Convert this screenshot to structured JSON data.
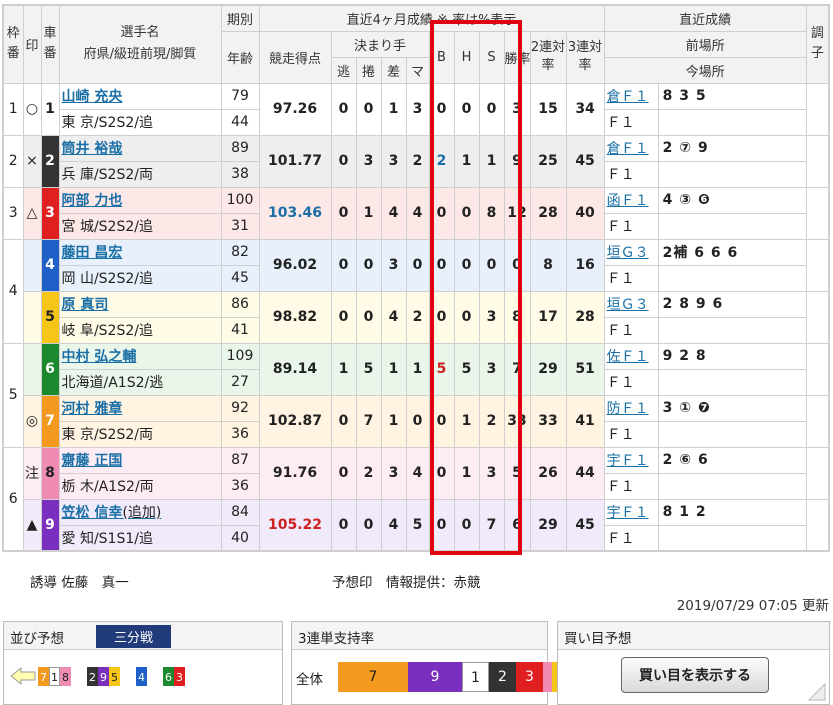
{
  "header": {
    "frame_label": "枠番",
    "mark_label": "印",
    "car_label": "車番",
    "rider_label1": "選手名",
    "rider_label2": "府県/級班前現/脚質",
    "period_label": "期別",
    "age_label": "年齢",
    "recent_label": "直近4ヶ月成績  ※ 率は%表示",
    "points_label": "競走得点",
    "kimarite_label": "決まり手",
    "k1": "逃",
    "k2": "捲",
    "k3": "差",
    "k4": "マ",
    "b": "B",
    "h": "H",
    "s": "S",
    "win_label": "勝率",
    "two_label": "2連対率",
    "three_label": "3連対率",
    "recent_results_label": "直近成績",
    "prev_place_label": "前場所",
    "cur_place_label": "今場所",
    "condition_label": "調子"
  },
  "riders": [
    {
      "frame": "1",
      "mark": "○",
      "car": "1",
      "car_bg": "#ffffff",
      "car_fg": "#222222",
      "name": "山崎 充央",
      "pref": "東 京/S2S2/追",
      "period": "79",
      "age": "44",
      "points": "97.26",
      "pt_color": "",
      "k1": "0",
      "k2": "0",
      "k3": "1",
      "k4": "3",
      "b": "0",
      "h": "0",
      "s": "0",
      "s_color": "",
      "win": "3",
      "two": "15",
      "three": "34",
      "prev": "倉Ｆ１",
      "prev_res": "8 3 5",
      "cur": "Ｆ１",
      "cur_res": "",
      "row_bg": "#ffffff"
    },
    {
      "frame": "2",
      "mark": "×",
      "car": "2",
      "car_bg": "#333333",
      "car_fg": "#ffffff",
      "name": "筒井 裕哉",
      "pref": "兵 庫/S2S2/両",
      "period": "89",
      "age": "38",
      "points": "101.77",
      "pt_color": "",
      "k1": "0",
      "k2": "3",
      "k3": "3",
      "k4": "2",
      "b": "2",
      "h": "1",
      "s": "1",
      "s_color": "blue",
      "win": "9",
      "two": "25",
      "three": "45",
      "prev": "倉Ｆ１",
      "prev_res": "2 ⑦ 9",
      "cur": "Ｆ１",
      "cur_res": "",
      "row_bg": "#eeeeee"
    },
    {
      "frame": "3",
      "mark": "△",
      "car": "3",
      "car_bg": "#e02020",
      "car_fg": "#ffffff",
      "name": "阿部 力也",
      "pref": "宮 城/S2S2/追",
      "period": "100",
      "age": "31",
      "points": "103.46",
      "pt_color": "blue",
      "k1": "0",
      "k2": "1",
      "k3": "4",
      "k4": "4",
      "b": "0",
      "h": "0",
      "s": "8",
      "s_color": "",
      "win": "12",
      "two": "28",
      "three": "40",
      "prev": "函Ｆ１",
      "prev_res": "4 ③ ❻",
      "cur": "Ｆ１",
      "cur_res": "",
      "row_bg": "#fde8e8"
    },
    {
      "frame": "4",
      "mark": "",
      "car": "4",
      "car_bg": "#1f5fc8",
      "car_fg": "#ffffff",
      "name": "藤田 昌宏",
      "pref": "岡 山/S2S2/追",
      "period": "82",
      "age": "45",
      "points": "96.02",
      "pt_color": "",
      "k1": "0",
      "k2": "0",
      "k3": "3",
      "k4": "0",
      "b": "0",
      "h": "0",
      "s": "0",
      "s_color": "",
      "win": "0",
      "two": "8",
      "three": "16",
      "prev": "垣Ｇ３",
      "prev_res": "2補 6 6 6",
      "cur": "Ｆ１",
      "cur_res": "",
      "row_bg": "#e8f0fb"
    },
    {
      "frame": "4",
      "mark": "",
      "car": "5",
      "car_bg": "#f5c518",
      "car_fg": "#222222",
      "name": "原 真司",
      "pref": "岐 阜/S2S2/追",
      "period": "86",
      "age": "41",
      "points": "98.82",
      "pt_color": "",
      "k1": "0",
      "k2": "0",
      "k3": "4",
      "k4": "2",
      "b": "0",
      "h": "0",
      "s": "3",
      "s_color": "",
      "win": "8",
      "two": "17",
      "three": "28",
      "prev": "垣Ｇ３",
      "prev_res": "2 8 9 6",
      "cur": "Ｆ１",
      "cur_res": "",
      "row_bg": "#fffbe6"
    },
    {
      "frame": "5",
      "mark": "",
      "car": "6",
      "car_bg": "#1b8a2e",
      "car_fg": "#ffffff",
      "name": "中村 弘之輔",
      "pref": "北海道/A1S2/逃",
      "period": "109",
      "age": "27",
      "points": "89.14",
      "pt_color": "",
      "k1": "1",
      "k2": "5",
      "k3": "1",
      "k4": "1",
      "b": "5",
      "h": "5",
      "s": "3",
      "s_color": "red",
      "win": "7",
      "two": "29",
      "three": "51",
      "prev": "佐Ｆ１",
      "prev_res": "9 2 8",
      "cur": "Ｆ１",
      "cur_res": "",
      "row_bg": "#eaf6ea"
    },
    {
      "frame": "5",
      "mark": "◎",
      "car": "7",
      "car_bg": "#f39a1e",
      "car_fg": "#ffffff",
      "name": "河村 雅章",
      "pref": "東 京/S2S2/両",
      "period": "92",
      "age": "36",
      "points": "102.87",
      "pt_color": "",
      "k1": "0",
      "k2": "7",
      "k3": "1",
      "k4": "0",
      "b": "0",
      "h": "1",
      "s": "2",
      "s_color": "",
      "win": "33",
      "two": "33",
      "three": "41",
      "prev": "防Ｆ１",
      "prev_res": "3 ① ❼",
      "cur": "Ｆ１",
      "cur_res": "",
      "row_bg": "#fff3e2"
    },
    {
      "frame": "6",
      "mark": "注",
      "car": "8",
      "car_bg": "#f08cb4",
      "car_fg": "#222222",
      "name": "齋藤 正国",
      "pref": "栃 木/A1S2/両",
      "period": "87",
      "age": "36",
      "points": "91.76",
      "pt_color": "",
      "k1": "0",
      "k2": "2",
      "k3": "3",
      "k4": "4",
      "b": "0",
      "h": "1",
      "s": "3",
      "s_color": "",
      "win": "5",
      "two": "26",
      "three": "44",
      "prev": "宇Ｆ１",
      "prev_res": "2 ⑥ 6",
      "cur": "Ｆ１",
      "cur_res": "",
      "row_bg": "#fdecf3"
    },
    {
      "frame": "6",
      "mark": "▲",
      "car": "9",
      "car_bg": "#7b2fbf",
      "car_fg": "#ffffff",
      "name": "笠松 信幸",
      "name_suffix": "(追加)",
      "pref": "愛 知/S1S1/追",
      "period": "84",
      "age": "40",
      "points": "105.22",
      "pt_color": "red",
      "k1": "0",
      "k2": "0",
      "k3": "4",
      "k4": "5",
      "b": "0",
      "h": "0",
      "s": "7",
      "s_color": "",
      "win": "6",
      "two": "29",
      "three": "45",
      "prev": "宇Ｆ１",
      "prev_res": "8 1 2",
      "cur": "Ｆ１",
      "cur_res": "",
      "row_bg": "#f1eafa"
    }
  ],
  "footer": {
    "lead": "誘導 佐藤　真一",
    "provider": "予想印　情報提供：赤競",
    "updated": "2019/07/29 07:05 更新"
  },
  "lineup_box": {
    "title": "並び予想",
    "badge": "三分戦",
    "cars": [
      {
        "n": "7",
        "bg": "#f39a1e",
        "fg": "#ffffff"
      },
      {
        "n": "1",
        "bg": "#ffffff",
        "fg": "#222222"
      },
      {
        "n": "8",
        "bg": "#f08cb4",
        "fg": "#222222"
      },
      {
        "n": "2",
        "bg": "#333333",
        "fg": "#ffffff"
      },
      {
        "n": "9",
        "bg": "#7b2fbf",
        "fg": "#ffffff"
      },
      {
        "n": "5",
        "bg": "#f5c518",
        "fg": "#222222"
      },
      {
        "n": "4",
        "bg": "#1f5fc8",
        "fg": "#ffffff"
      },
      {
        "n": "6",
        "bg": "#1b8a2e",
        "fg": "#ffffff"
      },
      {
        "n": "3",
        "bg": "#e02020",
        "fg": "#ffffff"
      }
    ]
  },
  "support_box": {
    "title": "3連単支持率",
    "all_label": "全体",
    "segments": [
      {
        "n": "7",
        "bg": "#f39a1e",
        "fg": "#222222",
        "share": 0.34
      },
      {
        "n": "9",
        "bg": "#7b2fbf",
        "fg": "#ffffff",
        "share": 0.26
      },
      {
        "n": "1",
        "bg": "#ffffff",
        "fg": "#222222",
        "share": 0.13
      },
      {
        "n": "2",
        "bg": "#333333",
        "fg": "#ffffff",
        "share": 0.13
      },
      {
        "n": "3",
        "bg": "#e02020",
        "fg": "#ffffff",
        "share": 0.13
      },
      {
        "n": "",
        "bg": "#f08cb4",
        "fg": "#222222",
        "share": 0.045
      },
      {
        "n": "",
        "bg": "#f5c518",
        "fg": "#222222",
        "share": 0.03
      },
      {
        "n": "",
        "bg": "#1f5fc8",
        "fg": "#ffffff",
        "share": 0.025
      },
      {
        "n": "",
        "bg": "#1b8a2e",
        "fg": "#ffffff",
        "share": 0.02
      }
    ]
  },
  "buy_box": {
    "title": "買い目予想",
    "button": "買い目を表示する"
  }
}
